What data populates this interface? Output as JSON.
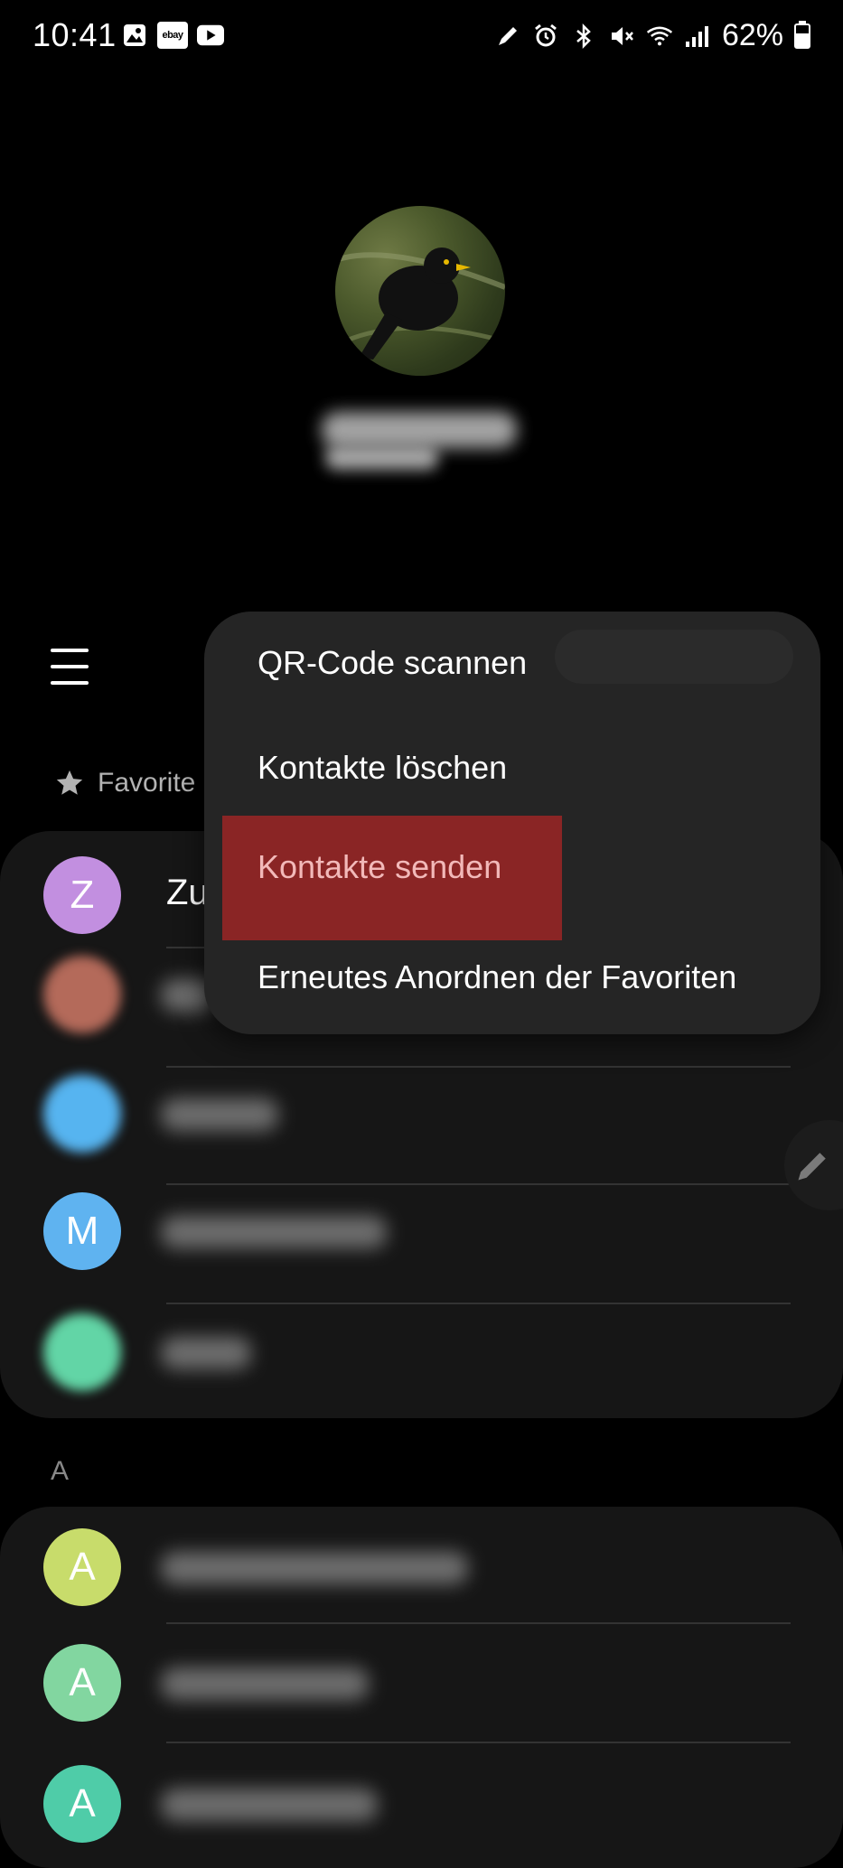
{
  "status_bar": {
    "time": "10:41",
    "left_icons": [
      "gallery-icon",
      "ebay-icon",
      "youtube-icon"
    ],
    "ebay_text": "ebay",
    "right_icons": [
      "pen-icon",
      "alarm-icon",
      "bluetooth-icon",
      "mute-icon",
      "wifi-icon",
      "signal-icon"
    ],
    "battery": "62%"
  },
  "header": {
    "favorites_label": "Favorite"
  },
  "favorites": [
    {
      "initial": "Z",
      "color": "#c28fe0",
      "name": "Zu"
    },
    {
      "initial": "",
      "color": "#b46a5a",
      "name": ""
    },
    {
      "initial": "",
      "color": "#56b4f0",
      "name": ""
    },
    {
      "initial": "M",
      "color": "#5fb3f0",
      "name": ""
    },
    {
      "initial": "",
      "color": "#62d5a6",
      "name": ""
    }
  ],
  "section_a": {
    "letter": "A",
    "rows": [
      {
        "initial": "A",
        "color": "#c8dc6b"
      },
      {
        "initial": "A",
        "color": "#82d6a0"
      },
      {
        "initial": "A",
        "color": "#4fcca8"
      }
    ]
  },
  "menu": {
    "items": [
      {
        "label": "QR-Code scannen"
      },
      {
        "label": "Kontakte löschen"
      },
      {
        "label": "Kontakte senden"
      },
      {
        "label": "Erneutes Anordnen der Favoriten"
      }
    ],
    "highlight_color": "#8a2525"
  }
}
